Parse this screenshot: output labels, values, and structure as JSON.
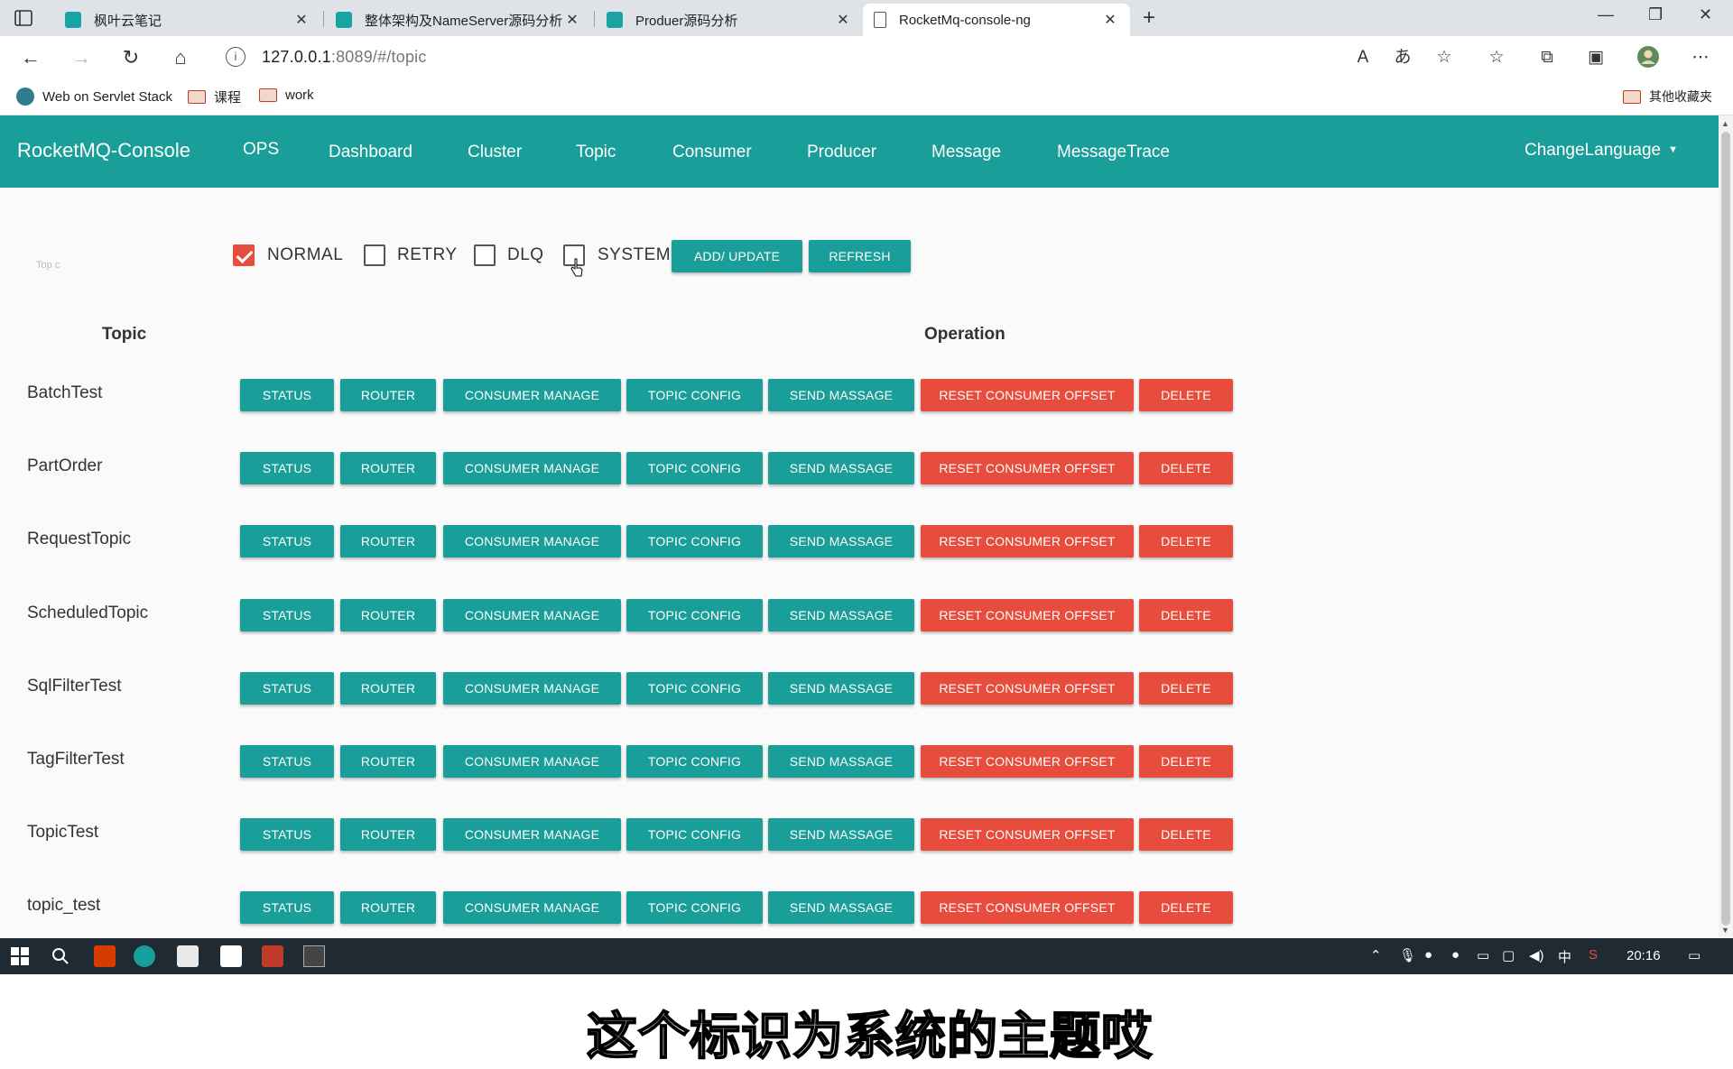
{
  "browser": {
    "tabs": [
      {
        "title": "枫叶云笔记",
        "active": false
      },
      {
        "title": "整体架构及NameServer源码分析",
        "active": false
      },
      {
        "title": "Produer源码分析",
        "active": false
      },
      {
        "title": "RocketMq-console-ng",
        "active": true
      }
    ],
    "url_host": "127.0.0.1",
    "url_rest": ":8089/#/topic",
    "bookmarks": [
      "Web on Servlet Stack",
      "课程",
      "work"
    ],
    "other_bookmarks": "其他收藏夹"
  },
  "app": {
    "brand": "RocketMQ-Console",
    "nav": [
      "OPS",
      "Dashboard",
      "Cluster",
      "Topic",
      "Consumer",
      "Producer",
      "Message",
      "MessageTrace"
    ],
    "change_language": "ChangeLanguage"
  },
  "filters": {
    "faint_label": "Top c",
    "normal": {
      "label": "NORMAL",
      "checked": true
    },
    "retry": {
      "label": "RETRY",
      "checked": false
    },
    "dlq": {
      "label": "DLQ",
      "checked": false
    },
    "system": {
      "label": "SYSTEM",
      "checked": false
    },
    "add_update": "ADD/ UPDATE",
    "refresh": "REFRESH"
  },
  "table": {
    "col_topic": "Topic",
    "col_operation": "Operation",
    "actions": {
      "status": "STATUS",
      "router": "ROUTER",
      "consumer_manage": "CONSUMER MANAGE",
      "topic_config": "TOPIC CONFIG",
      "send_message": "SEND MASSAGE",
      "reset_offset": "RESET CONSUMER OFFSET",
      "delete": "DELETE"
    },
    "rows": [
      "BatchTest",
      "PartOrder",
      "RequestTopic",
      "ScheduledTopic",
      "SqlFilterTest",
      "TagFilterTest",
      "TopicTest",
      "topic_test"
    ]
  },
  "subtitle": "这个标识为系统的主题哎",
  "taskbar": {
    "ime": "中",
    "time": "20:16"
  },
  "colors": {
    "teal": "#1a9e9a",
    "red": "#e84c3d"
  }
}
